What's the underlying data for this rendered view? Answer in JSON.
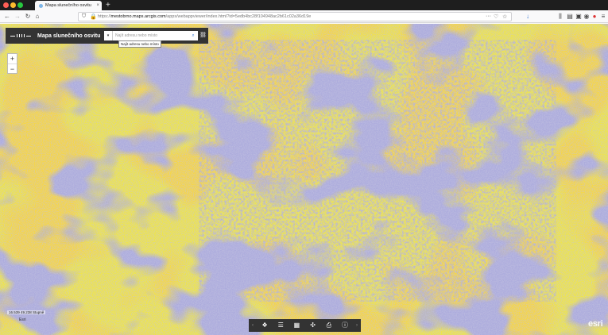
{
  "browser": {
    "tab_title": "Mapa slunečního osvitu",
    "tab_close": "×",
    "new_tab": "+",
    "url_prefix": "https://",
    "url_host": "mestobrno.maps.arcgis.com",
    "url_path": "/apps/webappviewer/index.html?id=5edb4bc28f104948ac2b61c02a36d19e",
    "traffic_colors": [
      "#ff5f57",
      "#febc2e",
      "#28c840"
    ]
  },
  "icons": {
    "back": "back-arrow-icon",
    "forward": "forward-arrow-icon",
    "reload": "reload-icon",
    "home": "home-icon",
    "shield": "tracking-shield-icon",
    "lock": "lock-icon",
    "more": "page-actions-icon",
    "pocket": "pocket-icon",
    "bookmark": "star-icon",
    "download": "download-icon",
    "library": "library-icon",
    "sidebar": "sidebar-icon",
    "screenshot": "screenshot-icon",
    "extension": "extension-icon",
    "opera": "extension-red-icon",
    "menu": "hamburger-menu-icon"
  },
  "app": {
    "title": "Mapa slunečního osvitu",
    "search_placeholder": "Najít adresu nebo místo",
    "search_tooltip": "Najít adresu nebo místo",
    "dropdown_glyph": "▾",
    "search_glyph": "⌕",
    "link_glyph": "⛓"
  },
  "map": {
    "zoom_in": "+",
    "zoom_out": "−",
    "scale_text": "16.539 49.238 Stupně",
    "attribution": "Esri",
    "esri_logo": "esri",
    "colors": {
      "high": "#f6ec3a",
      "mid": "#e2db7a",
      "low": "#6f6dba",
      "dark": "#e8a80f"
    }
  },
  "toolbar": {
    "prev": "‹",
    "next": "›",
    "tools": [
      {
        "name": "layer-list",
        "glyph": "❖"
      },
      {
        "name": "legend",
        "glyph": "☰"
      },
      {
        "name": "basemap-gallery",
        "glyph": "▦"
      },
      {
        "name": "measurement",
        "glyph": "✣"
      },
      {
        "name": "print",
        "glyph": "⎙"
      },
      {
        "name": "about",
        "glyph": "ⓘ"
      }
    ]
  }
}
